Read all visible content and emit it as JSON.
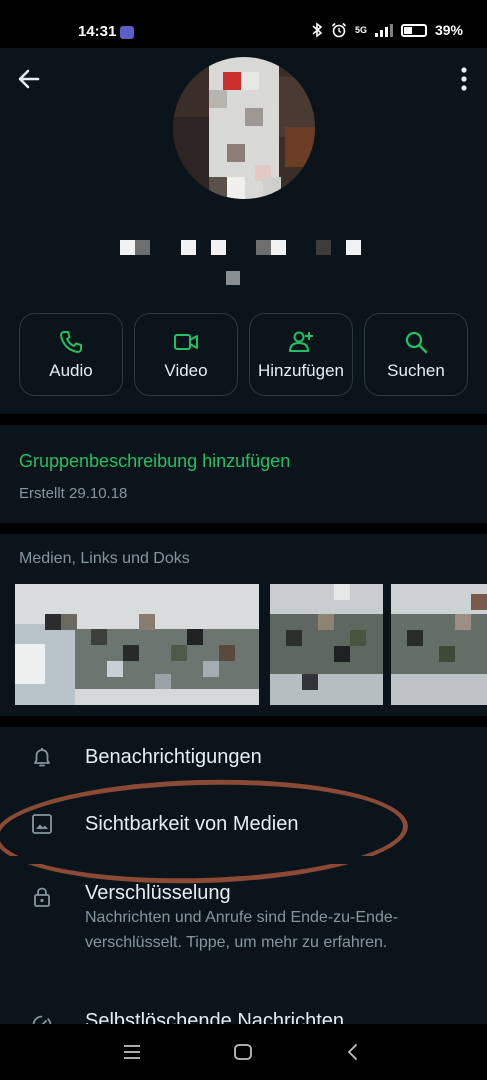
{
  "status_bar": {
    "time": "14:31",
    "network": "5G",
    "battery": "39%",
    "battery_level": 0.39
  },
  "header": {
    "back_icon": "arrow-left-icon",
    "more_icon": "more-vertical-icon"
  },
  "actions": [
    {
      "label": "Audio",
      "icon": "phone-icon"
    },
    {
      "label": "Video",
      "icon": "video-camera-icon"
    },
    {
      "label": "Hinzufügen",
      "icon": "add-person-icon"
    },
    {
      "label": "Suchen",
      "icon": "search-icon"
    }
  ],
  "group_info": {
    "description_link": "Gruppenbeschreibung hinzufügen",
    "created": "Erstellt 29.10.18"
  },
  "media": {
    "title": "Medien, Links und Doks"
  },
  "menu": {
    "notifications": "Benachrichtigungen",
    "media_visibility": "Sichtbarkeit von Medien",
    "encryption": "Verschlüsselung",
    "encryption_sub": "Nachrichten und Anrufe sind Ende-zu-Ende-verschlüsselt. Tippe, um mehr zu erfahren.",
    "disappearing": "Selbstlöschende Nachrichten"
  },
  "colors": {
    "background": "#0b141a",
    "accent_green": "#21c063",
    "secondary_text": "#8696a0",
    "annotation": "#8b4a35"
  }
}
